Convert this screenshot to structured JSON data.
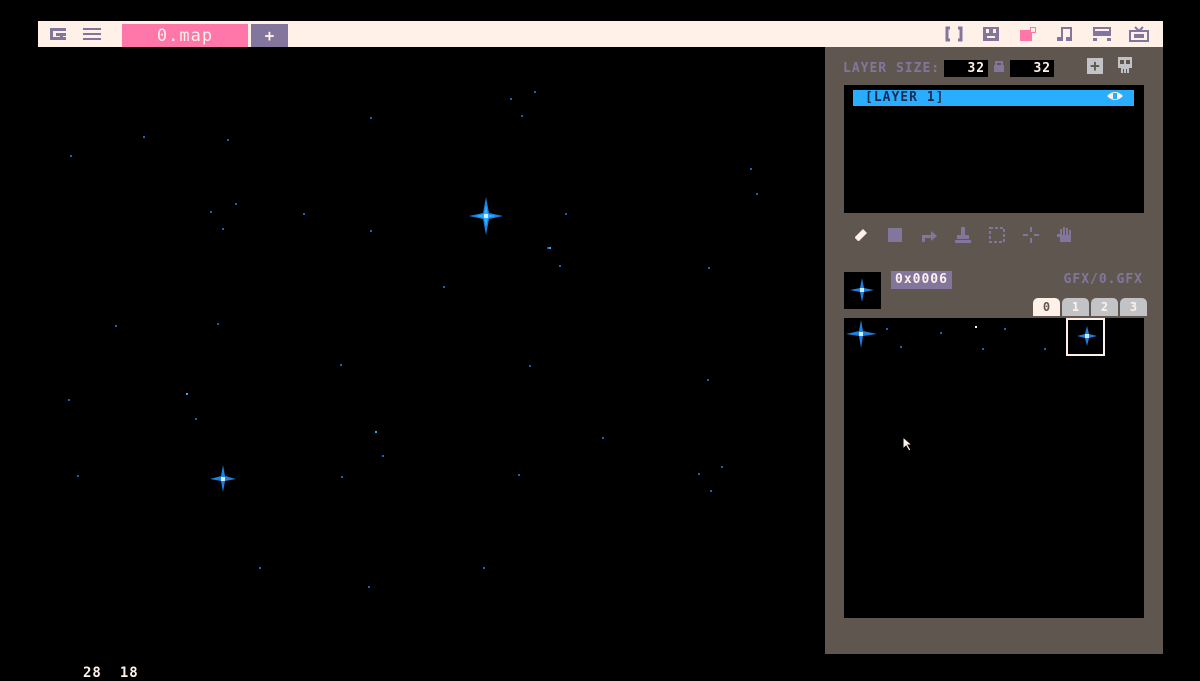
{
  "app": {
    "left_icons": [
      "logo-icon",
      "menu-icon"
    ],
    "tabs": [
      {
        "label": "0.map",
        "active": true
      }
    ],
    "add_tab_label": "+",
    "right_icons": [
      {
        "name": "code-icon",
        "glyph": "()",
        "active": false
      },
      {
        "name": "sprite-editor-icon",
        "glyph": "■",
        "active": false
      },
      {
        "name": "map-editor-icon",
        "glyph": "■",
        "active": true
      },
      {
        "name": "music-icon",
        "glyph": "♫",
        "active": false
      },
      {
        "name": "sfx-icon",
        "glyph": "▀",
        "active": false
      },
      {
        "name": "run-icon",
        "glyph": "♜",
        "active": false
      }
    ]
  },
  "canvas": {
    "cursor_x": "28",
    "cursor_y": "18"
  },
  "panel": {
    "layer_size_label": "LAYER SIZE:",
    "layer_width": "32",
    "layer_height": "32",
    "layers": [
      {
        "name": "[LAYER 1]",
        "visible": true
      }
    ],
    "tools": [
      "pencil-icon",
      "fill-rect-icon",
      "stamp-arrow-icon",
      "stamp-icon",
      "select-icon",
      "pan-icon",
      "hand-icon"
    ],
    "tile_id": "0x0006",
    "gfx_file": "GFX/0.GFX",
    "banks": [
      "0",
      "1",
      "2",
      "3"
    ],
    "active_bank": "0"
  },
  "colors": {
    "bar_bg": "#fff1e8",
    "accent": "#ff77a8",
    "muted": "#83769c",
    "panel_bg": "#5f574f",
    "layer_highlight": "#29adff",
    "star_blue": "#29adff"
  }
}
